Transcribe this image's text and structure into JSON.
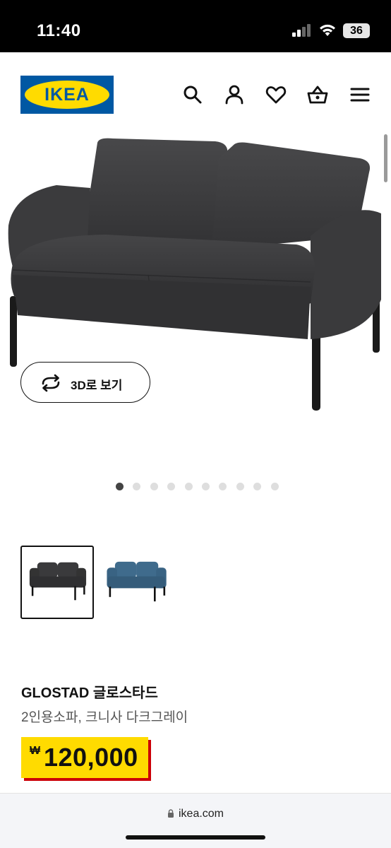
{
  "status_bar": {
    "time": "11:40",
    "battery": "36"
  },
  "header": {
    "logo_text": "IKEA",
    "icons": [
      "search-icon",
      "user-icon",
      "heart-icon",
      "basket-icon",
      "menu-icon"
    ]
  },
  "hero": {
    "view_3d_label": "3D로 보기",
    "carousel": {
      "total": 10,
      "active_index": 0
    }
  },
  "variants": [
    {
      "name": "dark-grey-variant",
      "color": "#3a3a3c",
      "selected": true
    },
    {
      "name": "blue-variant",
      "color": "#3f6b8c",
      "selected": false
    }
  ],
  "product": {
    "title": "GLOSTAD 글로스타드",
    "subtitle": "2인용소파, 크니사 다크그레이",
    "currency": "₩",
    "price": "120,000"
  },
  "browser": {
    "url": "ikea.com"
  },
  "colors": {
    "ikea_blue": "#0058a3",
    "ikea_yellow": "#ffdb00",
    "price_shadow": "#cc0008",
    "sofa_dark": "#3a3a3c",
    "sofa_blue": "#3f6b8c"
  }
}
